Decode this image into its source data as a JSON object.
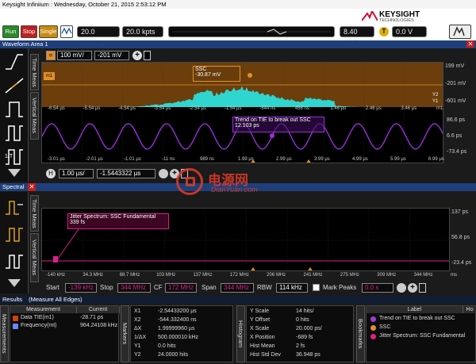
{
  "window": {
    "title": "Keysight Infiniium : Wednesday, October 21, 2015 2:53:12 PM"
  },
  "brand": {
    "name": "KEYSIGHT",
    "sub": "TECHNOLOGIES",
    "color": "#d40f2f"
  },
  "toolbar": {
    "run_label": "Run",
    "stop_label": "Stop",
    "single_label": "Single",
    "sample_rate": "20.0 GSa/s",
    "memory_depth": "20.0 kpts",
    "bandwidth": "8.40 GHz",
    "trigger_level": "0.0 V",
    "trigger_badge": "T"
  },
  "waveform_area": {
    "title": "Waveform Area 1",
    "scale": "100 mV/",
    "offset": "-201 mV",
    "top_axis_ticks": [
      "-6.54 µs",
      "-5.54 µs",
      "-4.54 µs",
      "-3.54 µs",
      "-2.54 µs",
      "-1.54 µs",
      "-544 ns",
      "456 ns",
      "1.46 µs",
      "2.46 µs",
      "3.46 µs",
      "m1"
    ],
    "top_right_levels": [
      "199 mV",
      "-201 mV",
      "-601 mV"
    ],
    "mid_axis_ticks": [
      "-3.01 µs",
      "-2.01 µs",
      "-1.01 µs",
      "-11 ns",
      "989 ns",
      "1.99 µs",
      "2.99 µs",
      "3.99 µs",
      "4.99 µs",
      "5.99 µs",
      "6.99 µs"
    ],
    "mid_right_levels": [
      "86.6 ps",
      "6.6 ps",
      "-73.4 ps"
    ],
    "ssc_label": "SSC",
    "ssc_value": "-30.87 mV",
    "trend_label": "Trend on TIE to break out SSC",
    "trend_value": "12.103 ps",
    "horiz_label": "H",
    "horiz_scale": "1.00 µs/",
    "horiz_offset": "-1.5443322 µs",
    "side_tabs": {
      "time": "Time Meas",
      "vertical": "Vertical Meas"
    },
    "channel_marker": "m1",
    "y2_marker": "Y2",
    "y1_marker": "Y1"
  },
  "spectral": {
    "title": "Spectral",
    "label": "Jitter Spectrum: SSC Fundamental",
    "value": "339 fs",
    "right_levels": [
      "137 ps",
      "56.8 ps",
      "-23.4 ps"
    ],
    "axis_ticks": [
      "-140 kHz",
      "34.3 MHz",
      "68.7 MHz",
      "103 MHz",
      "137 MHz",
      "172 MHz",
      "206 MHz",
      "241 MHz",
      "275 MHz",
      "309 MHz",
      "344 MHz",
      "ms"
    ],
    "start_label": "Start",
    "start_value": "-139 kHz",
    "stop_label": "Stop",
    "stop_value": "344 MHz",
    "cf_label": "CF",
    "cf_value": "172 MHz",
    "span_label": "Span",
    "span_value": "344 MHz",
    "rbw_label": "RBW",
    "rbw_value": "114 kHz",
    "mark_peaks_label": "Mark Peaks",
    "peak_value": "0.0 s",
    "side_tabs": {
      "time": "Time Meas",
      "vertical": "Vertical Meas"
    }
  },
  "results": {
    "title": "Results",
    "subtitle": "(Measure All Edges)",
    "side_tab": "Measurements",
    "columns": [
      "Measurement",
      "Current"
    ],
    "rows": [
      {
        "name": "Data TIE(m1)",
        "value": "-28.71 ps",
        "color": "#d04010"
      },
      {
        "name": "Frequency(mt)",
        "value": "964.24108 kHz",
        "color": "#6688ff"
      }
    ],
    "markers_tab": "Markers",
    "markers": [
      {
        "k": "X1",
        "v": "-2.54433200 µs"
      },
      {
        "k": "X2",
        "v": "-544.332400 ns"
      },
      {
        "k": "ΔX",
        "v": "1.99999960 µs"
      },
      {
        "k": "1/ΔX",
        "v": "500.000010 kHz"
      },
      {
        "k": "Y1",
        "v": "0.0 hits"
      },
      {
        "k": "Y2",
        "v": "24.0000 hits"
      }
    ],
    "histogram_tab": "Histogram",
    "histogram": [
      {
        "k": "Y Scale",
        "v": "14 hits/"
      },
      {
        "k": "Y Offset",
        "v": "0 hits"
      },
      {
        "k": "X Scale",
        "v": "20.000 ps/"
      },
      {
        "k": "X Position",
        "v": "-689 fs"
      },
      {
        "k": "Hist Mean",
        "v": "2 fs"
      },
      {
        "k": "Hist Std Dev",
        "v": "36.948 ps"
      }
    ],
    "bookmarks_tab": "Bookmarks",
    "bookmarks_header": "Label",
    "bookmarks_header2": "Ho",
    "bookmarks": [
      {
        "label": "Trend on TIE to break out SSC",
        "color": "#a23bd6"
      },
      {
        "label": "SSC",
        "color": "#e09030"
      },
      {
        "label": "Jitter Spectrum: SSC Fundamental",
        "color": "#e0207a"
      }
    ]
  },
  "watermark": {
    "main": "电源网",
    "sub": "DianYuan.com"
  },
  "colors": {
    "orange": "#e0902a",
    "purple": "#9a2fd8",
    "magenta": "#d8208a",
    "cyan": "#2fd6d0"
  }
}
